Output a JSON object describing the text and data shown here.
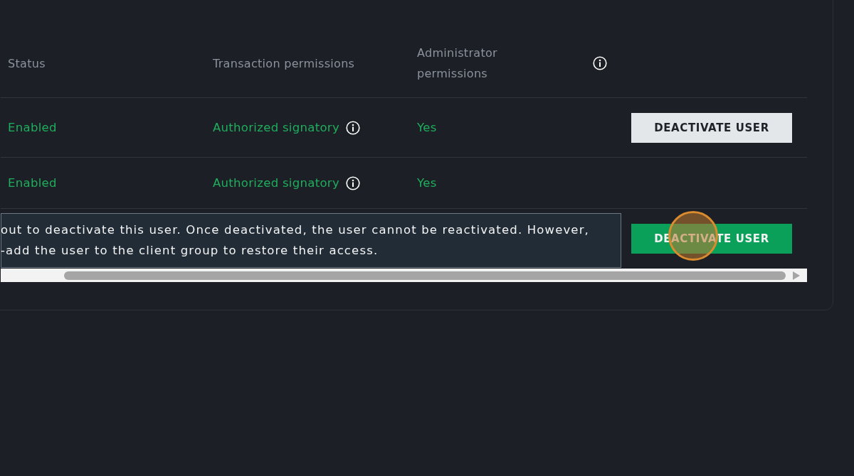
{
  "table": {
    "columns": [
      "Status",
      "Transaction permissions",
      "Administrator permissions"
    ],
    "rows": [
      {
        "status": "Enabled",
        "transaction": "Authorized signatory",
        "admin": "Yes",
        "button": {
          "label": "DEACTIVATE USER",
          "highlighted": false
        }
      },
      {
        "status": "Enabled",
        "transaction": "Authorized signatory",
        "admin": "Yes"
      },
      {
        "button": {
          "label": "DEACTIVATE USER",
          "highlighted": true
        },
        "click_indicator": true
      }
    ]
  },
  "tooltip": {
    "lines": [
      "out to deactivate this user. Once deactivated, the user cannot be reactivated. However,",
      "-add the user to the client group to restore their access."
    ]
  }
}
